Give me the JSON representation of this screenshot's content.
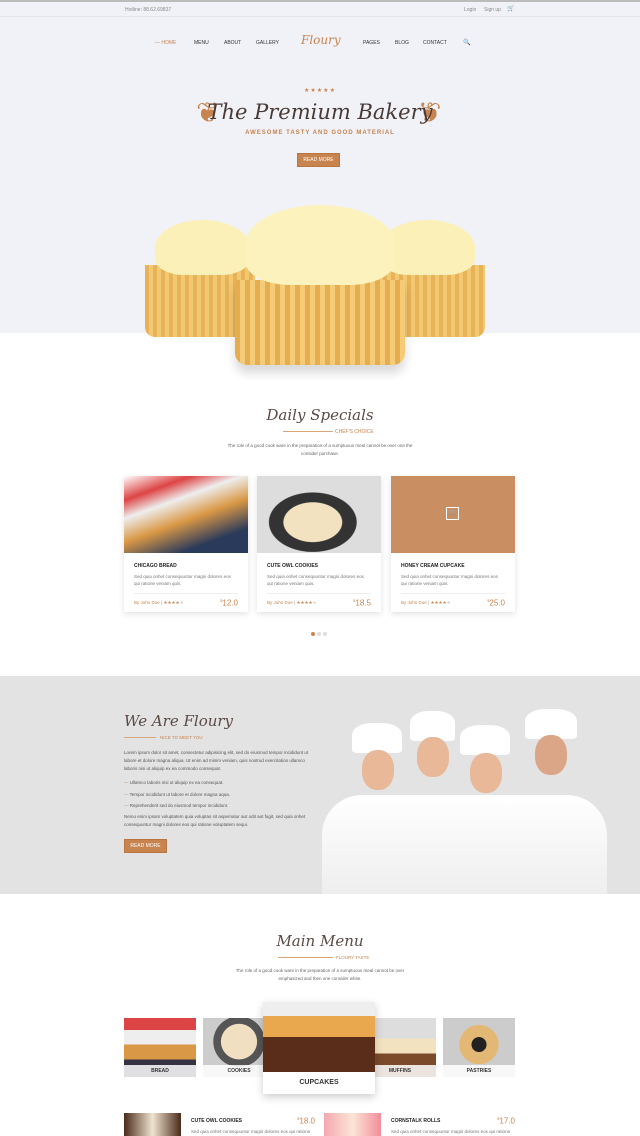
{
  "topbar": {
    "hotline": "Hotline: 88.62.69837",
    "login": "Login",
    "signup": "Sign up",
    "cart_icon": "cart-icon"
  },
  "nav": {
    "items": [
      "HOME",
      "MENU",
      "ABOUT",
      "GALLERY",
      "PAGES",
      "BLOG",
      "CONTACT"
    ],
    "logo": "Floury",
    "search_icon": "search-icon"
  },
  "hero": {
    "stars": "★★★★★",
    "title": "The Premium Bakery",
    "subtitle": "AWESOME TASTY AND GOOD MATERIAL",
    "button": "READ MORE"
  },
  "specials": {
    "title": "Daily Specials",
    "subtitle": "CHEF'S CHOICE",
    "description": "The role of a good cook ware in the preparation of a sumptuous meal cannot be over one the consider purchase.",
    "cards": [
      {
        "name": "CHICAGO BREAD",
        "text": "Sed quia onhet consequuntur magni dolores eos qui ratione veniam quis.",
        "author": "By John Doe",
        "rating": 4,
        "price": "12.0"
      },
      {
        "name": "CUTE OWL COOKIES",
        "text": "Sed quia onhet consequuntur magni dolores eos qui ratione veniam quis.",
        "author": "By John Doe",
        "rating": 4,
        "price": "18.5"
      },
      {
        "name": "HONEY CREAM CUPCAKE",
        "text": "Sed quia onhet consequuntur magni dolores eos qui ratione veniam quis.",
        "author": "By John Doe",
        "rating": 4,
        "price": "25.0"
      }
    ],
    "currency": "$"
  },
  "about": {
    "title": "We Are Floury",
    "subtitle": "NICE TO MEET YOU",
    "para1": "Lorem ipsum dolor sit amet, consectetur adipisicing elit, sed do eiusmod tempor incididunt ut labore et dolore magna aliqua. Ut enim ad minim veniam, quis nostrud exercitation ullamco laboris nisi ut aliquip ex ea commodo consequat.",
    "bullets": [
      "Ullamco laboris nisi ut aliquip ex ea consequat.",
      "Tempor incididunt ut labore et dolore magna aqua.",
      "Reprehenderit sed do eiusmod tempor incididunt."
    ],
    "para2": "Nemo enim ipsam voluptatem quia voluptas sit aspernatur aut odit aut fugit, sed quia onhet consequuntur magni dolores eos qui ratione voluptatem sequi.",
    "button": "READ MORE"
  },
  "menu": {
    "title": "Main Menu",
    "subtitle": "FLOURY TASTE",
    "description": "The role of a good cook ware in the preparation of a sumptuous meal cannot be over emphasized and then one consider white.",
    "categories": [
      "BREAD",
      "COOKIES",
      "CUPCAKES",
      "MUFFINS",
      "PASTRIES"
    ],
    "items": [
      {
        "name": "CUTE OWL COOKIES",
        "price": "18.0",
        "text": "Sed quia onhet consequuntur magni dolores eos qui ratione"
      },
      {
        "name": "CORNSTALK ROLLS",
        "price": "17.0",
        "text": "Sed quia onhet consequuntur magni dolores eos qui ratione"
      }
    ]
  }
}
